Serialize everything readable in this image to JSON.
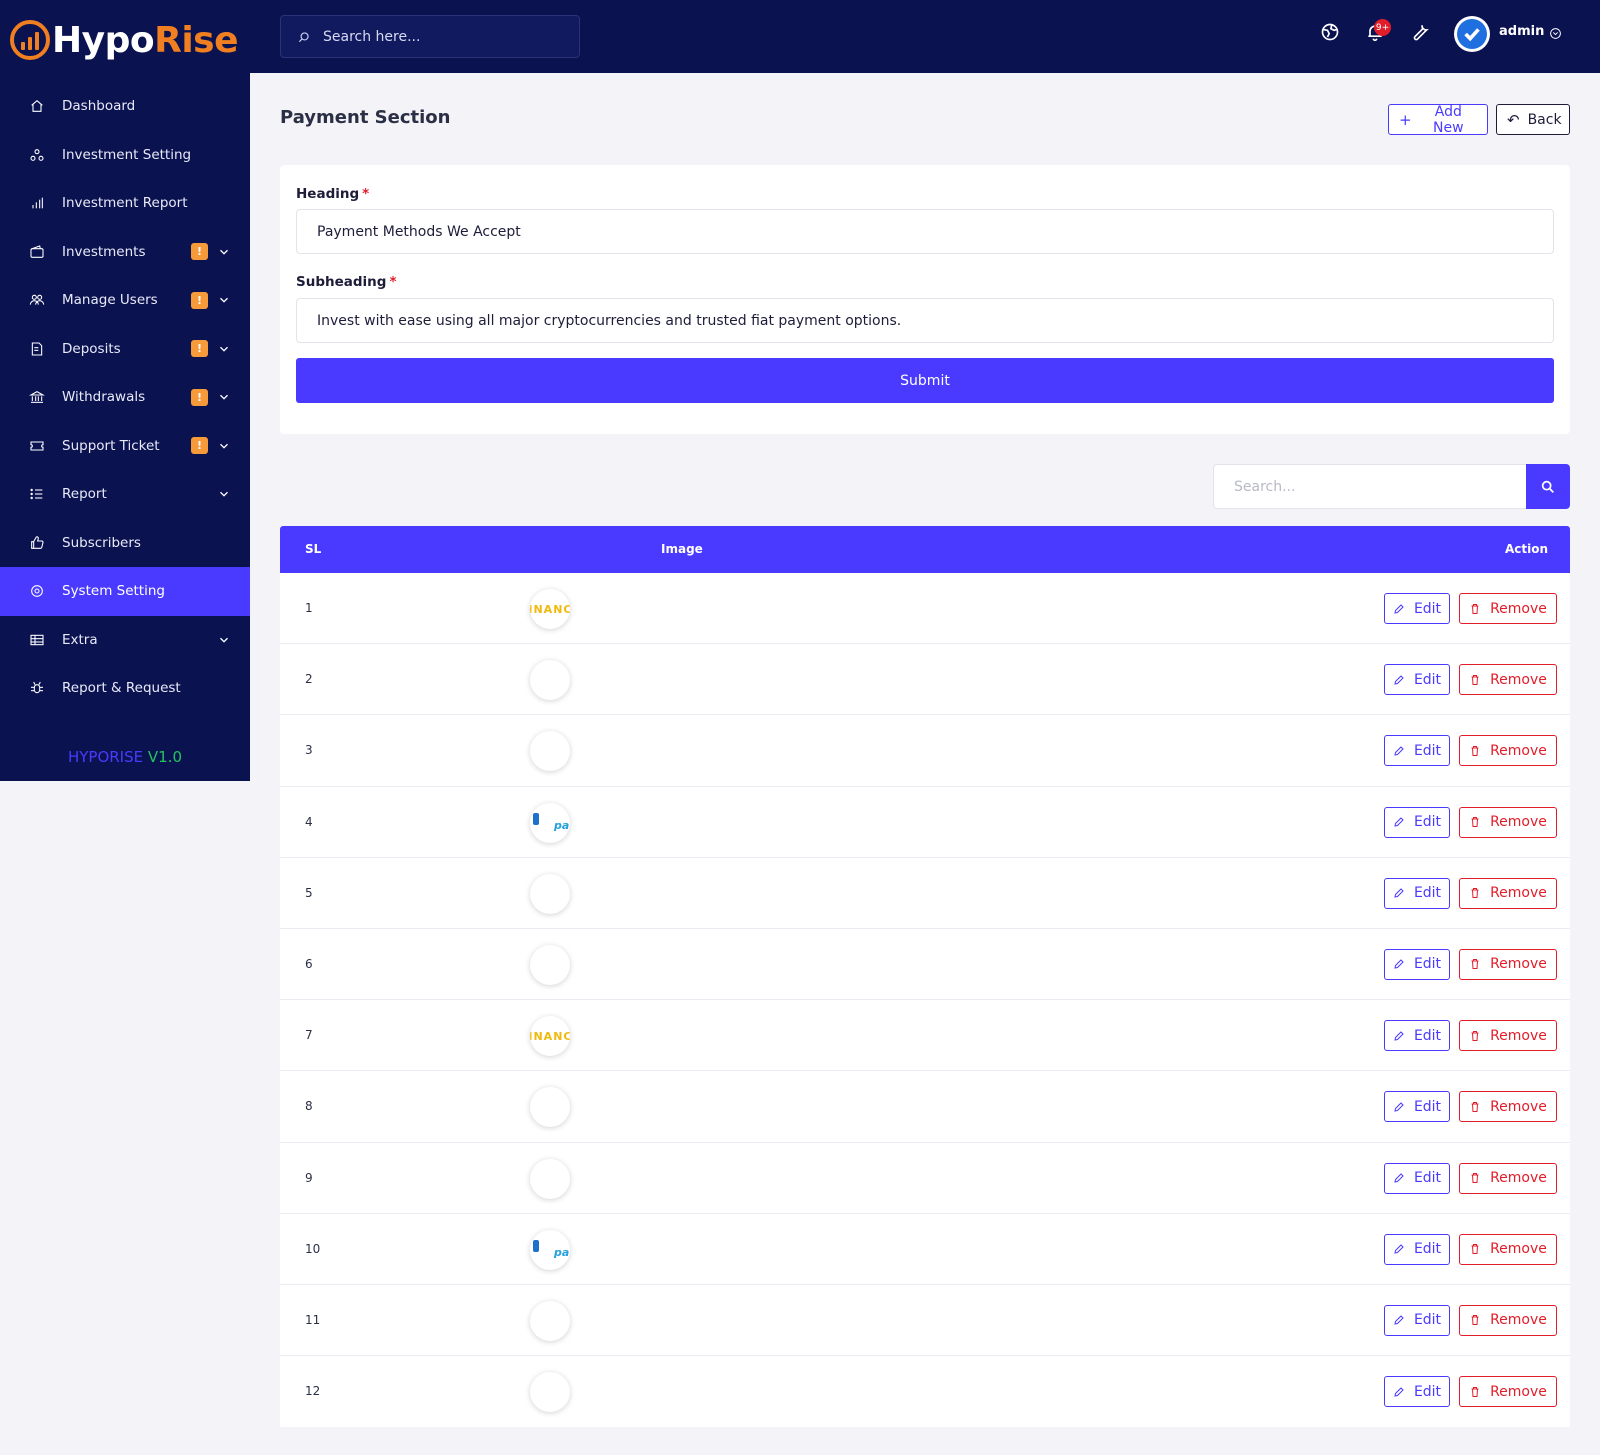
{
  "brand": {
    "name_part1": "Hypo",
    "name_part2": "Rise"
  },
  "sidebar": {
    "items": [
      {
        "label": "Dashboard",
        "icon": "home-icon"
      },
      {
        "label": "Investment Setting",
        "icon": "settings-icon"
      },
      {
        "label": "Investment Report",
        "icon": "bar-chart-icon"
      },
      {
        "label": "Investments",
        "icon": "wallet-icon",
        "badge": "!"
      },
      {
        "label": "Manage Users",
        "icon": "users-icon",
        "badge": "!"
      },
      {
        "label": "Deposits",
        "icon": "receipt-icon",
        "badge": "!"
      },
      {
        "label": "Withdrawals",
        "icon": "bank-icon",
        "badge": "!"
      },
      {
        "label": "Support Ticket",
        "icon": "ticket-icon",
        "badge": "!"
      },
      {
        "label": "Report",
        "icon": "list-icon"
      },
      {
        "label": "Subscribers",
        "icon": "thumbs-up-icon"
      },
      {
        "label": "System Setting",
        "icon": "gear-icon",
        "active": true
      },
      {
        "label": "Extra",
        "icon": "table-icon"
      },
      {
        "label": "Report & Request",
        "icon": "bug-icon"
      }
    ],
    "version_name": "HYPORISE",
    "version_number": "V1.0"
  },
  "topbar": {
    "search_placeholder": "Search here...",
    "notification_count": "9+",
    "user_name": "admin"
  },
  "main": {
    "title": "Payment Section",
    "add_new_label": "Add New",
    "back_label": "Back",
    "form": {
      "heading_label": "Heading",
      "heading_value": "Payment Methods We Accept",
      "subheading_label": "Subheading",
      "subheading_value": "Invest with ease using all major cryptocurrencies and trusted fiat payment options.",
      "required_mark": "*",
      "submit_label": "Submit"
    },
    "list_search_placeholder": "Search...",
    "table": {
      "columns": [
        "SL",
        "Image",
        "Action"
      ],
      "edit_label": "Edit",
      "remove_label": "Remove",
      "rows": [
        {
          "sl": "1",
          "image": "binance",
          "image_text": "BINANCE"
        },
        {
          "sl": "2",
          "image": "blank",
          "image_text": ""
        },
        {
          "sl": "3",
          "image": "blank",
          "image_text": ""
        },
        {
          "sl": "4",
          "image": "paypal",
          "image_text": "pa"
        },
        {
          "sl": "5",
          "image": "blank",
          "image_text": ""
        },
        {
          "sl": "6",
          "image": "blank",
          "image_text": ""
        },
        {
          "sl": "7",
          "image": "binance",
          "image_text": "BINANCE"
        },
        {
          "sl": "8",
          "image": "blank",
          "image_text": ""
        },
        {
          "sl": "9",
          "image": "blank",
          "image_text": ""
        },
        {
          "sl": "10",
          "image": "paypal",
          "image_text": "pa"
        },
        {
          "sl": "11",
          "image": "blank",
          "image_text": ""
        },
        {
          "sl": "12",
          "image": "blank",
          "image_text": ""
        }
      ]
    }
  },
  "colors": {
    "sidebar_bg": "#0b1250",
    "accent": "#4a3aff",
    "brand_orange": "#f07f22",
    "badge_orange": "#f79a3a",
    "danger": "#e11d2a"
  }
}
